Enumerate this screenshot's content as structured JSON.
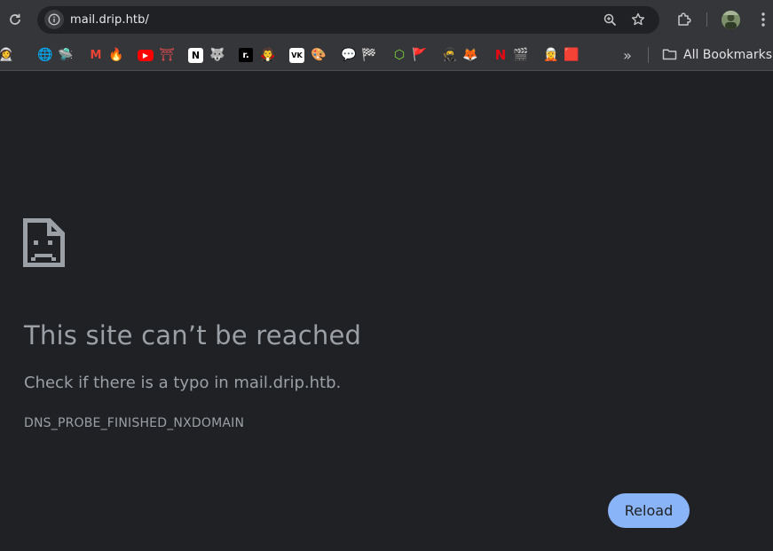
{
  "toolbar": {
    "url": "mail.drip.htb/",
    "icons": {
      "reload": "reload-icon",
      "site_info": "info-icon",
      "zoom": "zoom-icon",
      "bookmark": "star-icon",
      "extensions": "puzzle-icon",
      "profile": "avatar",
      "menu": "kebab-menu-icon"
    }
  },
  "bookmarks_bar": {
    "items": [
      {
        "name": "astronaut-favicon",
        "glyph": "👩‍🚀"
      },
      {
        "name": "globe-favicon",
        "glyph": "🌐"
      },
      {
        "name": "ufo-favicon",
        "glyph": "🛸"
      },
      {
        "name": "gmail-favicon",
        "glyph": "M"
      },
      {
        "name": "fire-favicon",
        "glyph": "🔥"
      },
      {
        "name": "youtube-favicon",
        "glyph": "▶"
      },
      {
        "name": "torii-favicon",
        "glyph": "⛩"
      },
      {
        "name": "notion-favicon",
        "glyph": "N"
      },
      {
        "name": "wolf-favicon",
        "glyph": "🐺"
      },
      {
        "name": "r-favicon",
        "glyph": "r."
      },
      {
        "name": "vampire-favicon",
        "glyph": "🧛"
      },
      {
        "name": "vk-favicon",
        "glyph": "VK"
      },
      {
        "name": "art-favicon",
        "glyph": "🎨"
      },
      {
        "name": "speech-favicon",
        "glyph": "💬"
      },
      {
        "name": "checkered-flag-favicon",
        "glyph": "🏁"
      },
      {
        "name": "cube-favicon",
        "glyph": "⬡"
      },
      {
        "name": "red-flag-favicon",
        "glyph": "🚩"
      },
      {
        "name": "ninja-favicon",
        "glyph": "🥷"
      },
      {
        "name": "fox-favicon",
        "glyph": "🦊"
      },
      {
        "name": "netflix-favicon",
        "glyph": "N"
      },
      {
        "name": "clapper-favicon",
        "glyph": "🎬"
      },
      {
        "name": "elf-favicon",
        "glyph": "🧝"
      },
      {
        "name": "red-app-favicon",
        "glyph": "🟥"
      }
    ],
    "overflow_glyph": "»",
    "all_bookmarks_label": "All Bookmarks"
  },
  "error_page": {
    "title": "This site can’t be reached",
    "detail": "Check if there is a typo in mail.drip.htb.",
    "error_code": "DNS_PROBE_FINISHED_NXDOMAIN",
    "reload_label": "Reload",
    "icon": "sad-page-icon"
  },
  "colors": {
    "background": "#202124",
    "toolbar": "#35363a",
    "text_secondary": "#9aa0a6",
    "accent": "#8ab4f8"
  }
}
